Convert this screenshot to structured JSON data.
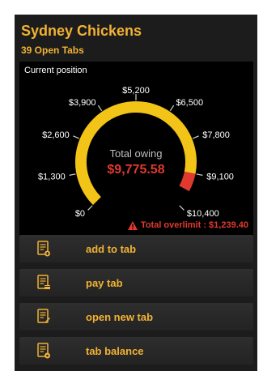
{
  "app": {
    "title": "Sydney Chickens",
    "subtitle": "39 Open Tabs"
  },
  "gauge": {
    "label": "Current position",
    "center_title": "Total owing",
    "center_value": "$9,775.58",
    "value": 9775.58,
    "limit": 9100,
    "max": 10400,
    "ticks": [
      "$0",
      "$1,300",
      "$2,600",
      "$3,900",
      "$5,200",
      "$6,500",
      "$7,800",
      "$9,100",
      "$10,400"
    ],
    "colors": {
      "normal": "#f2c417",
      "over": "#e03a2f",
      "text": "#ffffff",
      "value": "#e03a2f"
    }
  },
  "overlimit": {
    "text": "Total overlimit : $1,239.40",
    "icon": "warning-triangle-icon"
  },
  "menu": {
    "items": [
      {
        "label": "add to tab",
        "icon": "add-document-icon"
      },
      {
        "label": "pay tab",
        "icon": "pay-document-icon"
      },
      {
        "label": "open new tab",
        "icon": "edit-document-icon"
      },
      {
        "label": "tab balance",
        "icon": "balance-document-icon"
      }
    ]
  },
  "colors": {
    "accent": "#f2b233",
    "background": "#1c1c1c"
  }
}
